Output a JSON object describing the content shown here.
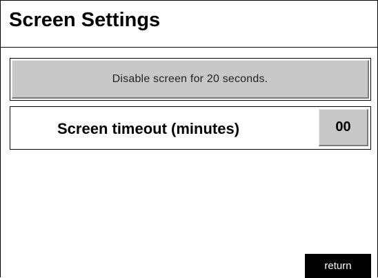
{
  "page": {
    "title": "Screen Settings"
  },
  "disable_button": {
    "label": "Disable screen for 20 seconds."
  },
  "timeout": {
    "label": "Screen timeout (minutes)",
    "value": "00"
  },
  "return_button": {
    "label": "return"
  },
  "colors": {
    "button_gray": "#c8c8c8",
    "return_bg": "#000000",
    "return_text": "#ffffff"
  }
}
